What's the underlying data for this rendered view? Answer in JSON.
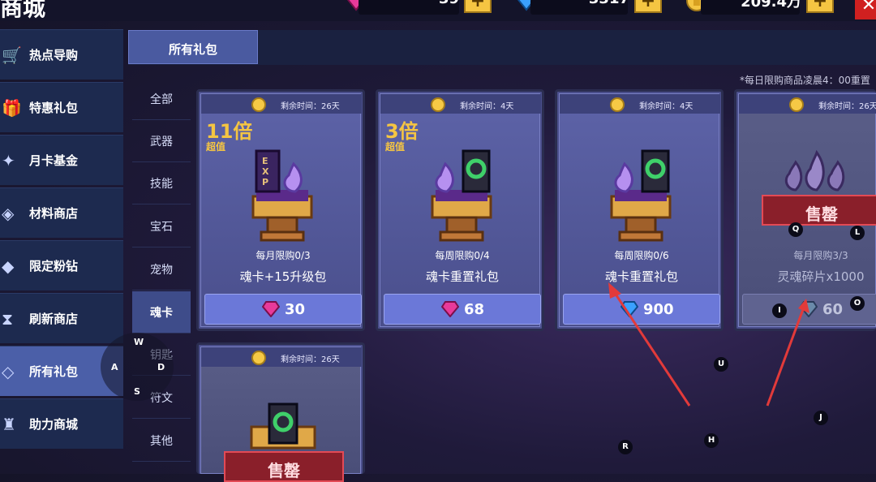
{
  "header": {
    "title": "商城",
    "resources": [
      {
        "name": "pink-gem",
        "value": "39",
        "color": "#e83a9a"
      },
      {
        "name": "blue-gem",
        "value": "3317",
        "color": "#3aa0ff"
      },
      {
        "name": "gold-coin",
        "value": "209.4万",
        "color": "#f5c542"
      }
    ],
    "plus_label": "+",
    "close_label": "✕"
  },
  "sidebar": {
    "items": [
      {
        "label": "热点导购",
        "icon": "cart-icon",
        "glyph": "🛒",
        "active": false
      },
      {
        "label": "特惠礼包",
        "icon": "gift-icon",
        "glyph": "🎁",
        "active": false
      },
      {
        "label": "月卡基金",
        "icon": "card-fund-icon",
        "glyph": "✦",
        "active": false
      },
      {
        "label": "材料商店",
        "icon": "material-icon",
        "glyph": "◈",
        "active": false
      },
      {
        "label": "限定粉钻",
        "icon": "diamond-icon",
        "glyph": "◆",
        "active": false
      },
      {
        "label": "刷新商店",
        "icon": "hourglass-icon",
        "glyph": "⧗",
        "active": false
      },
      {
        "label": "所有礼包",
        "icon": "all-packs-icon",
        "glyph": "◇",
        "active": true
      },
      {
        "label": "助力商城",
        "icon": "support-icon",
        "glyph": "♜",
        "active": false
      }
    ]
  },
  "tabs": [
    {
      "label": "所有礼包",
      "active": true
    }
  ],
  "subnav": {
    "items": [
      "全部",
      "武器",
      "技能",
      "宝石",
      "宠物",
      "魂卡",
      "钥匙",
      "符文",
      "其他"
    ],
    "active_index": 5
  },
  "notice": "*每日限购商品凌晨4：00重置",
  "cards": [
    {
      "timer": "剩余时间：26天",
      "multiplier": "11倍",
      "multiplier_sub": "超值",
      "limit": "每月限购0/3",
      "name": "魂卡+15升级包",
      "price": "30",
      "currency": "pink-gem",
      "sold_out": false,
      "art": "exp-card"
    },
    {
      "timer": "剩余时间：4天",
      "multiplier": "3倍",
      "multiplier_sub": "超值",
      "limit": "每周限购0/4",
      "name": "魂卡重置礼包",
      "price": "68",
      "currency": "pink-gem",
      "sold_out": false,
      "art": "reset-card"
    },
    {
      "timer": "剩余时间：4天",
      "multiplier": "",
      "multiplier_sub": "",
      "limit": "每周限购0/6",
      "name": "魂卡重置礼包",
      "price": "900",
      "currency": "blue-gem",
      "sold_out": false,
      "art": "reset-card"
    },
    {
      "timer": "剩余时间：26天",
      "multiplier": "",
      "multiplier_sub": "",
      "limit": "每月限购3/3",
      "name": "灵魂碎片x1000",
      "price": "60",
      "currency": "blue-gem",
      "sold_out": true,
      "sold_out_label": "售罄",
      "art": "soul-shards"
    },
    {
      "timer": "剩余时间：26天",
      "multiplier": "",
      "multiplier_sub": "",
      "limit": "",
      "name": "",
      "price": "",
      "currency": "",
      "sold_out": true,
      "sold_out_label": "售罄",
      "art": "reset-card"
    }
  ],
  "key_hints": {
    "joystick": {
      "up": "W",
      "left": "A",
      "right": "D",
      "down": "S"
    },
    "keys": [
      "Q",
      "L",
      "I",
      "O",
      "U",
      "J",
      "H",
      "R"
    ]
  }
}
